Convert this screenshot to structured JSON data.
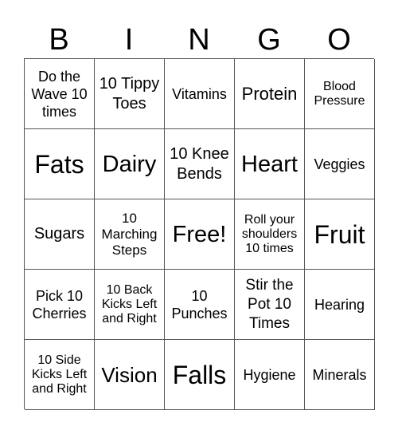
{
  "header": {
    "letters": [
      "B",
      "I",
      "N",
      "G",
      "O"
    ]
  },
  "grid": {
    "rows": [
      [
        "Do the Wave 10 times",
        "10 Tippy Toes",
        "Vitamins",
        "Protein",
        "Blood Pressure"
      ],
      [
        "Fats",
        "Dairy",
        "10 Knee Bends",
        "Heart",
        "Veggies"
      ],
      [
        "Sugars",
        "10 Marching Steps",
        "Free!",
        "Roll your shoulders 10 times",
        "Fruit"
      ],
      [
        "Pick 10 Cherries",
        "10 Back Kicks Left and Right",
        "10 Punches",
        "Stir the Pot 10 Times",
        "Hearing"
      ],
      [
        "10 Side Kicks Left and Right",
        "Vision",
        "Falls",
        "Hygiene",
        "Minerals"
      ]
    ]
  }
}
